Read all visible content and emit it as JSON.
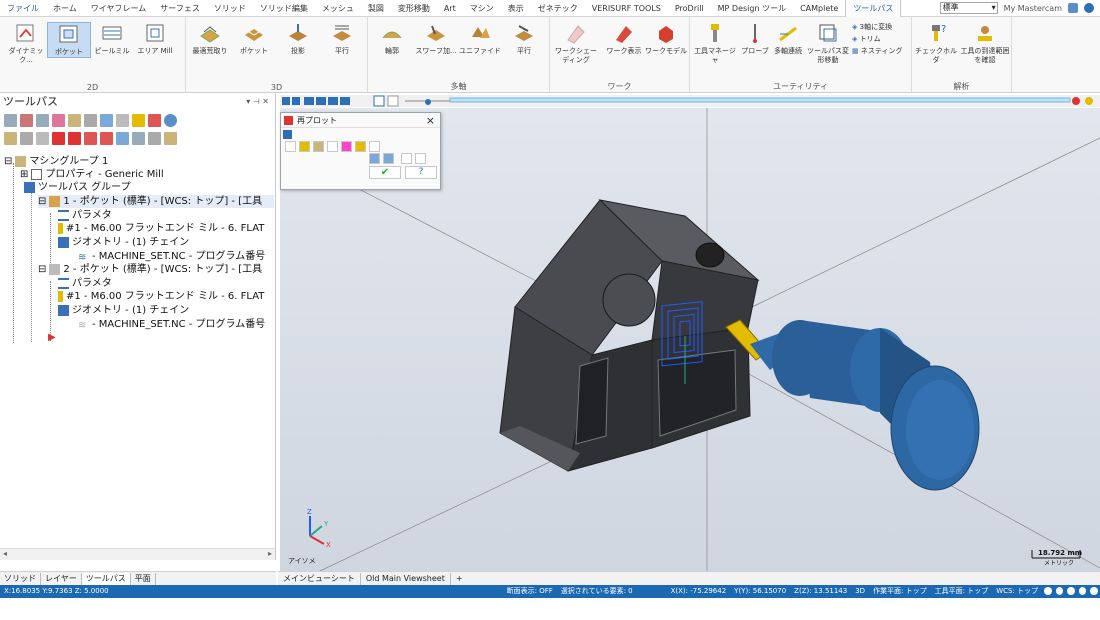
{
  "ribbon_tabs": [
    "ファイル",
    "ホーム",
    "ワイヤフレーム",
    "サーフェス",
    "ソリッド",
    "ソリッド編集",
    "メッシュ",
    "製図",
    "変形移動",
    "Art",
    "マシン",
    "表示",
    "ゼネテック",
    "VERISURF TOOLS",
    "ProDrill",
    "MP Design ツール",
    "CAMplete",
    "ツールパス"
  ],
  "active_tab": "ツールパス",
  "top_right": {
    "mode": "標準",
    "product": "My Mastercam"
  },
  "ribbon": {
    "g2d": {
      "label": "2D",
      "buttons": [
        "ダイナミック...",
        "ポケット",
        "ピールミル",
        "エリア Mill"
      ]
    },
    "g3d": {
      "label": "3D",
      "buttons": [
        "最適荒取り",
        "ポケット",
        "投影",
        "平行"
      ]
    },
    "gmulti": {
      "label": "多軸",
      "buttons": [
        "輪郭",
        "スワーフ加...",
        "ユニファイド",
        "平行"
      ]
    },
    "gwork": {
      "label": "ワーク",
      "buttons": [
        "ワークシェーディング",
        "ワーク表示",
        "ワークモデル"
      ]
    },
    "gutil": {
      "label": "ユーティリティ",
      "buttons": [
        "工具マネージャ",
        "プローブ",
        "多軸連続",
        "ツールパス変形移動"
      ],
      "small": [
        "3軸に変換",
        "トリム",
        "ネスティング"
      ]
    },
    "ganal": {
      "label": "解析",
      "buttons": [
        "チェックホルダ",
        "工具の到達範囲を確認"
      ]
    }
  },
  "left_panel": {
    "title": "ツールパス",
    "tree": [
      "マシングループ 1",
      "プロパティ - Generic Mill",
      "ツールパス グループ",
      "1 - ポケット (標準) - [WCS: トップ] - [工具",
      "パラメタ",
      "#1 - M6.00 フラットエンド ミル - 6. FLAT",
      "ジオメトリ - (1) チェイン",
      "- MACHINE_SET.NC - プログラム番号",
      "2 - ポケット (標準) - [WCS: トップ] - [工具",
      "パラメタ",
      "#1 - M6.00 フラットエンド ミル - 6. FLAT",
      "ジオメトリ - (1) チェイン",
      "- MACHINE_SET.NC - プログラム番号"
    ],
    "bottom_tabs": [
      "ソリッド",
      "レイヤー",
      "ツールパス",
      "平面"
    ]
  },
  "dialog": {
    "title": "再プロット"
  },
  "viewport": {
    "view_label": "アイソメ",
    "scale": "18.792 mm",
    "scale_unit": "メトリック",
    "sheets": [
      "メインビューシート",
      "Old Main Viewsheet",
      "+"
    ]
  },
  "status": {
    "left": "X:16.8035  Y:9.7363  Z: 5.0000",
    "section": "断面表示: OFF",
    "selected": "選択されている要素: 0",
    "x": "X(X): -75.29642",
    "y": "Y(Y): 56.15070",
    "z": "Z(Z): 13.51143",
    "dim": "3D",
    "cplane": "作業平面: トップ",
    "tplane": "工具平面: トップ",
    "wcs": "WCS: トップ"
  },
  "colors": {
    "accent": "#1f5fa8",
    "status_bar": "#1c69b3",
    "part": "#3c3d40",
    "tool_blue": "#2f6aa7",
    "tool_yellow": "#e3bb00",
    "path": "#1e5cff"
  }
}
